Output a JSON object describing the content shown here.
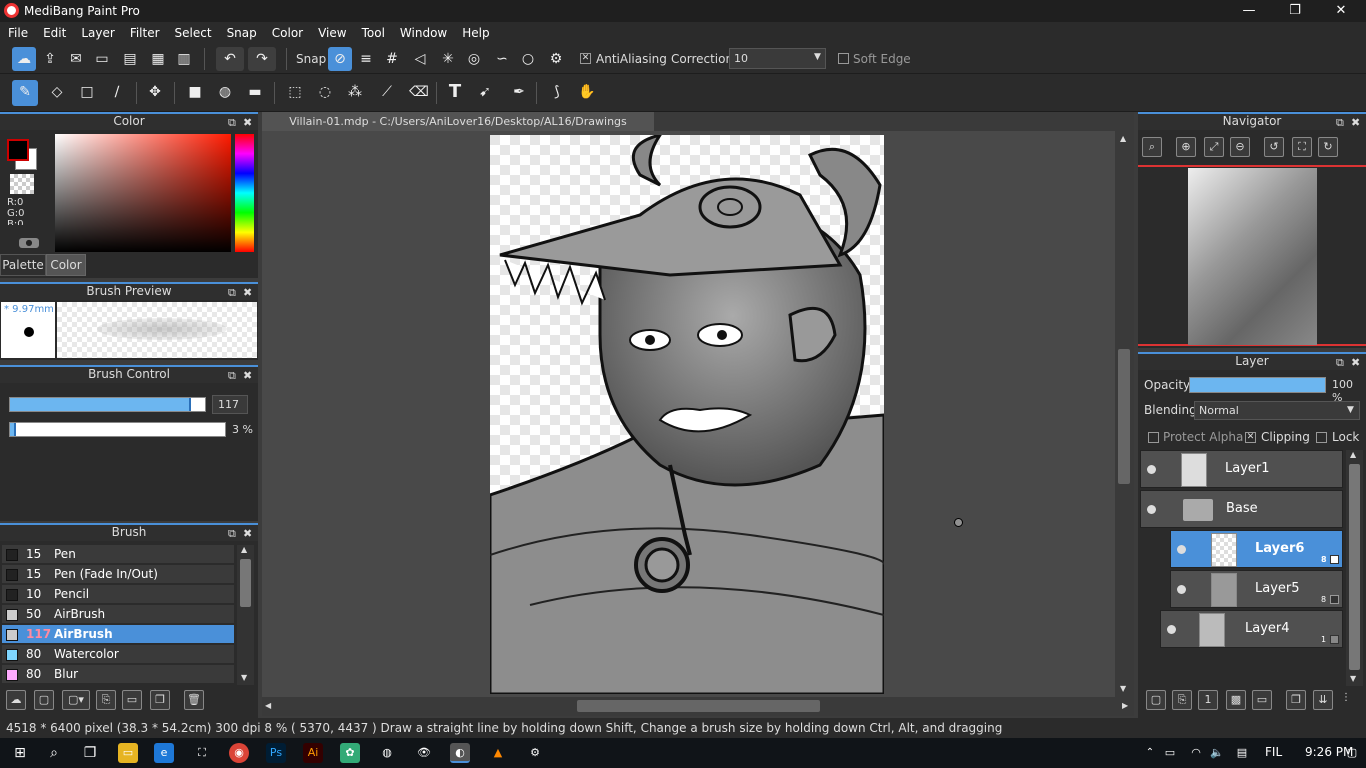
{
  "window": {
    "title": "MediBang Paint Pro",
    "minimize": "—",
    "maximize": "❐",
    "close": "✕"
  },
  "menu": [
    "File",
    "Edit",
    "Layer",
    "Filter",
    "Select",
    "Snap",
    "Color",
    "View",
    "Tool",
    "Window",
    "Help"
  ],
  "toolbar": {
    "snap_label": "Snap",
    "antialiasing_label": "AntiAliasing",
    "correction_label": "Correction",
    "correction_value": "10",
    "soft_edge_label": "Soft Edge"
  },
  "color_panel": {
    "title": "Color",
    "r": "R:0",
    "g": "G:0",
    "b": "B:0",
    "tab_palette": "Palette",
    "tab_color": "Color"
  },
  "brush_preview": {
    "title": "Brush Preview",
    "size": "* 9.97mm"
  },
  "brush_control": {
    "title": "Brush Control",
    "size_value": "117",
    "opacity_value": "3 %",
    "size_fraction": 0.93,
    "opacity_fraction": 0.03
  },
  "brush_panel": {
    "title": "Brush",
    "items": [
      {
        "size": "15",
        "name": "Pen",
        "color": "#222222"
      },
      {
        "size": "15",
        "name": "Pen (Fade In/Out)",
        "color": "#222222"
      },
      {
        "size": "10",
        "name": "Pencil",
        "color": "#222222"
      },
      {
        "size": "50",
        "name": "AirBrush",
        "color": "#cccccc"
      },
      {
        "size": "117",
        "name": "AirBrush",
        "color": "#cccccc",
        "selected": true
      },
      {
        "size": "80",
        "name": "Watercolor",
        "color": "#7fd6ff"
      },
      {
        "size": "80",
        "name": "Blur",
        "color": "#ffaaff"
      }
    ]
  },
  "document": {
    "tab": "Villain-01.mdp - C:/Users/AniLover16/Desktop/AL16/Drawings"
  },
  "navigator": {
    "title": "Navigator"
  },
  "layer_panel": {
    "title": "Layer",
    "opacity_label": "Opacity",
    "opacity_value": "100 %",
    "opacity_fraction": 1.0,
    "blending_label": "Blending",
    "blending_value": "Normal",
    "protect_alpha": "Protect Alpha",
    "clipping": "Clipping",
    "lock": "Lock",
    "layers": [
      {
        "name": "Layer1",
        "badge": ""
      },
      {
        "name": "Base",
        "badge": ""
      },
      {
        "name": "Layer6",
        "badge": "8",
        "selected": true
      },
      {
        "name": "Layer5",
        "badge": "8"
      },
      {
        "name": "Layer4",
        "badge": "1"
      }
    ]
  },
  "status": {
    "text": "4518 * 6400 pixel   (38.3 * 54.2cm)   300 dpi   8 %   ( 5370, 4437 )   Draw a straight line by holding down Shift, Change a brush size by holding down Ctrl, Alt, and dragging"
  },
  "taskbar": {
    "lang": "FIL",
    "time": "9:26 PM"
  },
  "colors": {
    "accent": "#4a90d9",
    "fg_color": "#000000",
    "bg_color": "#ffffff"
  }
}
